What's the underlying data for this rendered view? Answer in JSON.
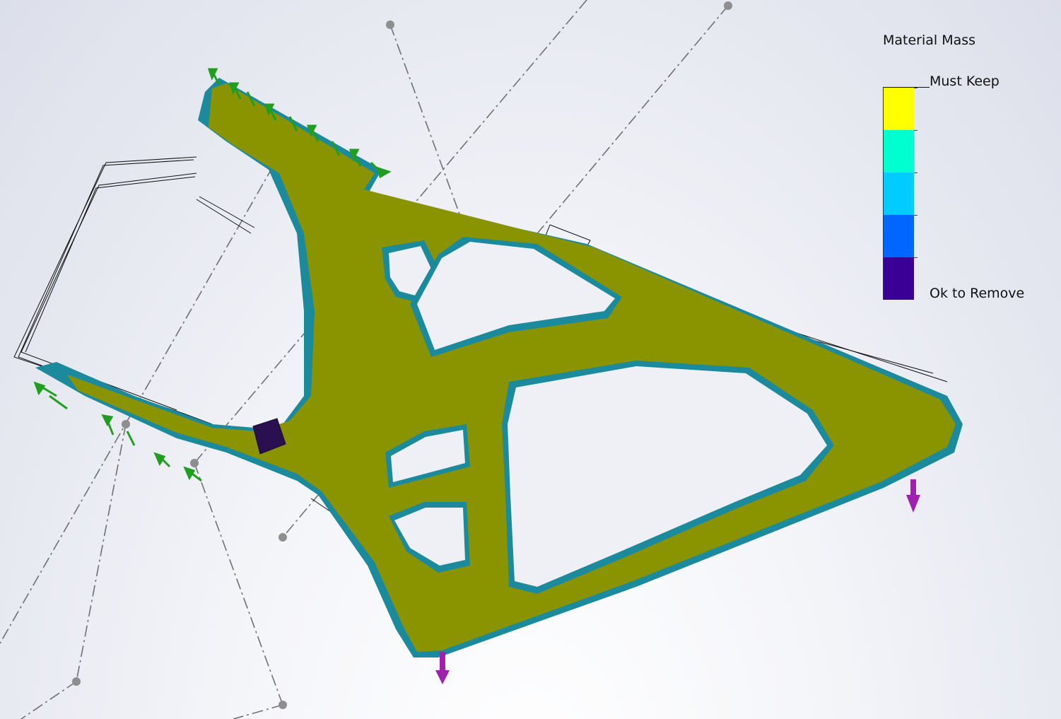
{
  "legend": {
    "title": "Material Mass",
    "top_label": "Must Keep",
    "bottom_label": "Ok to Remove",
    "colors": [
      "#ffff00",
      "#00ffd0",
      "#00ccff",
      "#0066ff",
      "#3a0096"
    ]
  },
  "model": {
    "part_color": "#8a9400",
    "edge_color": "#1a8a9c",
    "fixture_color": "#1f9e1f",
    "load_color": "#a020b0",
    "marker_color": "#2a1050"
  }
}
